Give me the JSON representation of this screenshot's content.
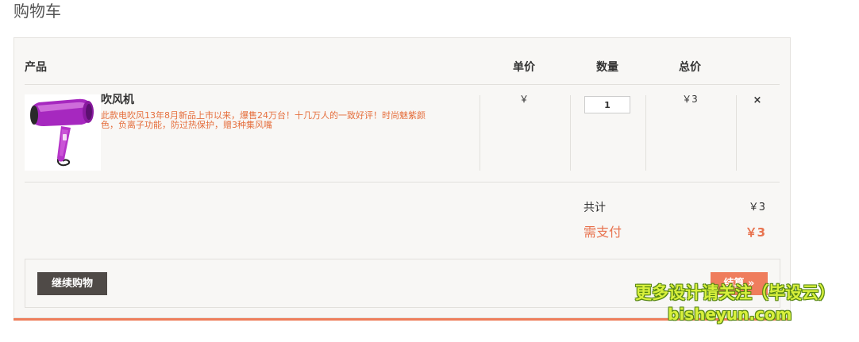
{
  "page": {
    "title": "购物车"
  },
  "table": {
    "headers": {
      "product": "产品",
      "unit_price": "单价",
      "quantity": "数量",
      "total": "总价"
    },
    "rows": [
      {
        "name": "吹风机",
        "description": "此款电吹风13年8月新品上市以来，爆售24万台！十几万人的一致好评！时尚魅紫颜色，负离子功能，防过热保护，赠3种集风嘴",
        "unit_price": "￥",
        "quantity": "1",
        "line_total": "￥3",
        "remove_icon": "×"
      }
    ]
  },
  "summary": {
    "subtotal_label": "共计",
    "subtotal_value": "￥3",
    "pay_label": "需支付",
    "pay_value": "￥3"
  },
  "actions": {
    "continue_label": "继续购物",
    "checkout_label": "结算 »"
  },
  "watermark": {
    "line1": "更多设计请关注（毕设云）",
    "line2": "bisheyun.com"
  },
  "colors": {
    "accent": "#ee7d5a",
    "pay_text": "#e8734f",
    "continue_button": "#4f4a47",
    "panel_background": "#f8f7f5",
    "product_color": "#a83cc8"
  }
}
